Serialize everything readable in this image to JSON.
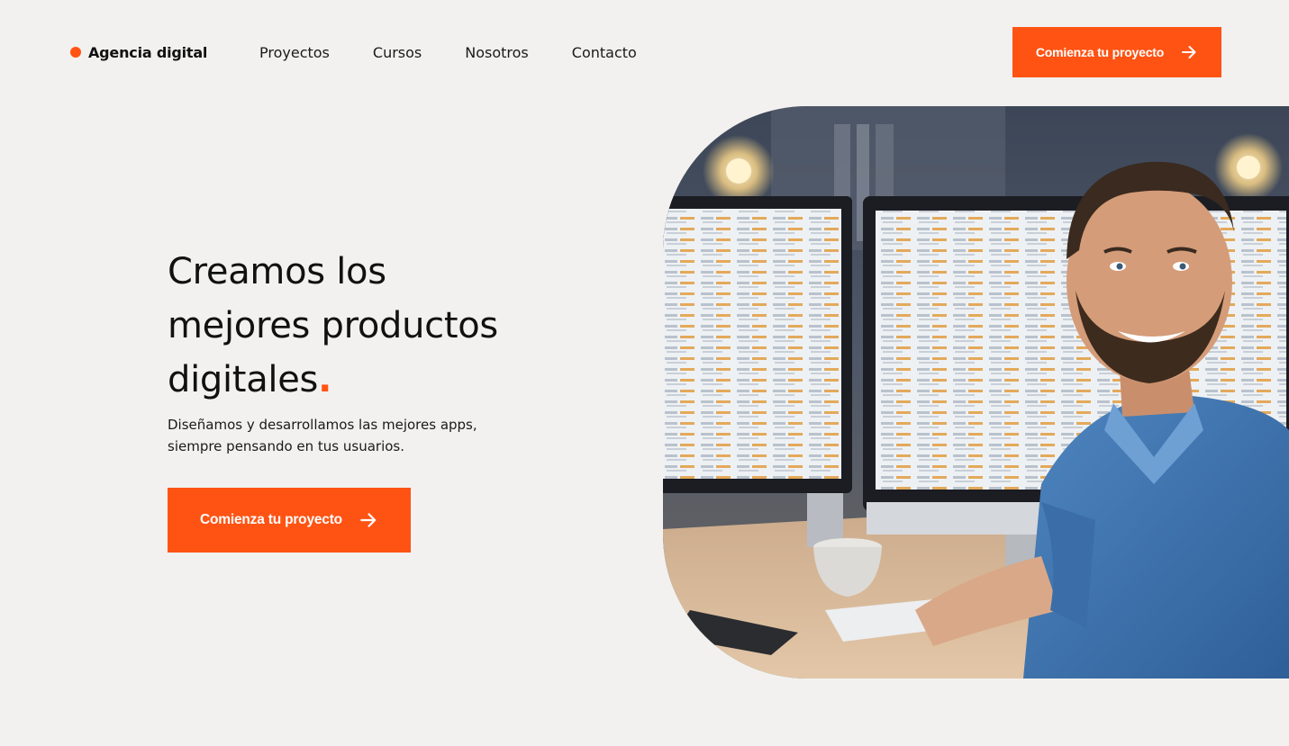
{
  "colors": {
    "accent": "#ff5314",
    "background": "#f2f1ef",
    "text": "#111111"
  },
  "header": {
    "brand": {
      "name": "Agencia digital",
      "dot_icon": "orange-dot-icon"
    },
    "nav_items": [
      {
        "label": "Proyectos"
      },
      {
        "label": "Cursos"
      },
      {
        "label": "Nosotros"
      },
      {
        "label": "Contacto"
      }
    ],
    "cta": {
      "label": "Comienza tu proyecto",
      "icon": "arrow-right-icon"
    }
  },
  "hero": {
    "title_lines": [
      "Creamos los",
      "mejores productos",
      "digitales"
    ],
    "title_accent": ".",
    "subtitle_lines": [
      "Diseñamos y desarrollamos las mejores apps,",
      "siempre pensando en tus usuarios."
    ],
    "cta": {
      "label": "Comienza tu proyecto",
      "icon": "arrow-right-icon"
    },
    "image": {
      "icon": "developer-photo"
    }
  }
}
